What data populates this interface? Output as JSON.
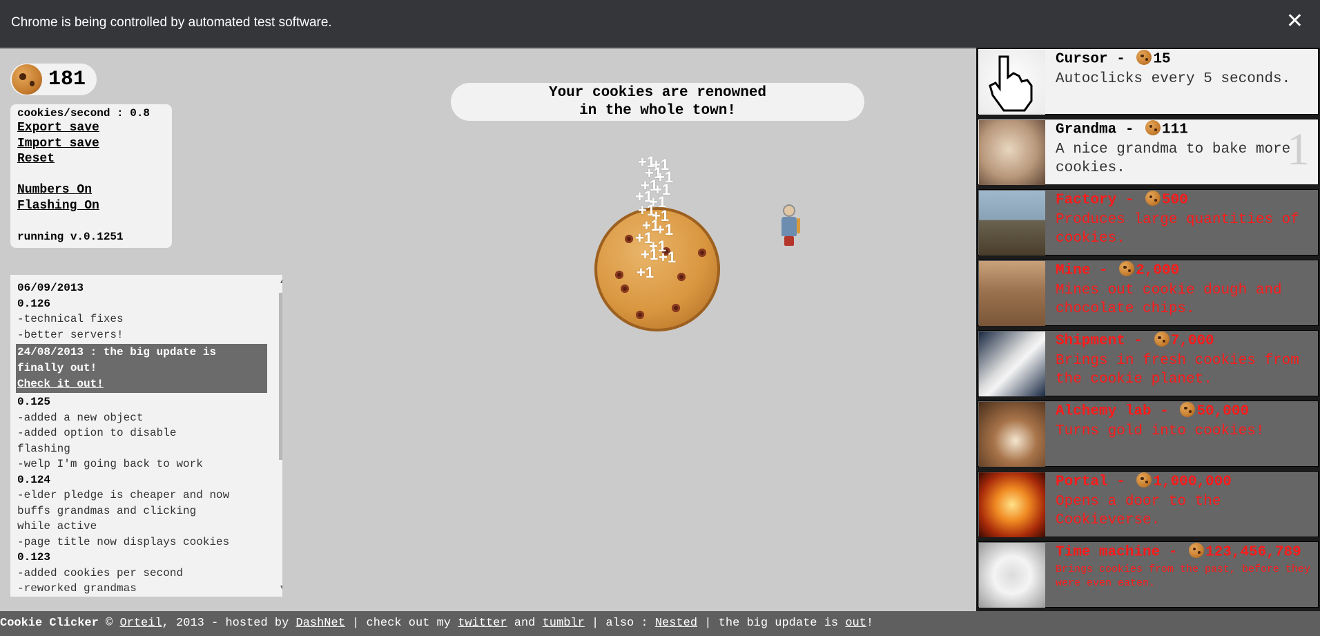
{
  "automation_bar": {
    "message": "Chrome is being controlled by automated test software.",
    "close_glyph": "✕"
  },
  "counter": {
    "cookies": "181",
    "icon": "cookie-icon"
  },
  "stats": {
    "cps": "cookies/second : 0.8",
    "export": "Export save",
    "import": "Import save",
    "reset": "Reset",
    "numbers": "Numbers On",
    "flashing": "Flashing On",
    "version": "running v.0.1251"
  },
  "news": {
    "lines": [
      {
        "text": "06/09/2013",
        "type": "head"
      },
      {
        "text": "0.126",
        "type": "head"
      },
      {
        "text": "-technical fixes",
        "type": "sub"
      },
      {
        "text": "-better servers!",
        "type": "sub"
      }
    ],
    "highlight": {
      "line1": "24/08/2013 : the big update is",
      "line2": "finally out!",
      "link": "Check it out!"
    },
    "lines2": [
      {
        "text": "0.125",
        "type": "head"
      },
      {
        "text": "-added a new object",
        "type": "sub"
      },
      {
        "text": "-added option to disable",
        "type": "sub"
      },
      {
        "text": "flashing",
        "type": "sub"
      },
      {
        "text": "-welp I'm going back to work",
        "type": "sub"
      },
      {
        "text": "0.124",
        "type": "head"
      },
      {
        "text": "-elder pledge is cheaper and now",
        "type": "sub"
      },
      {
        "text": "buffs grandmas and clicking",
        "type": "sub"
      },
      {
        "text": "while active",
        "type": "sub"
      },
      {
        "text": "-page title now displays cookies",
        "type": "sub"
      },
      {
        "text": "0.123",
        "type": "head"
      },
      {
        "text": "-added cookies per second",
        "type": "sub"
      },
      {
        "text": "-reworked grandmas",
        "type": "sub"
      }
    ],
    "scroll_up": "▲",
    "scroll_down": "▼"
  },
  "headline": {
    "line1": "Your cookies are renowned",
    "line2": "in the whole town!"
  },
  "floating_text": "+1",
  "store": {
    "items": [
      {
        "name": "Cursor",
        "price": "15",
        "desc": "Autoclicks every 5 seconds.",
        "state": "on",
        "owned": ""
      },
      {
        "name": "Grandma",
        "price": "111",
        "desc": "A nice grandma to bake more cookies.",
        "state": "on",
        "owned": "1"
      },
      {
        "name": "Factory",
        "price": "500",
        "desc": "Produces large quantities of cookies.",
        "state": "off",
        "owned": ""
      },
      {
        "name": "Mine",
        "price": "2,000",
        "desc": "Mines out cookie dough and chocolate chips.",
        "state": "off",
        "owned": ""
      },
      {
        "name": "Shipment",
        "price": "7,000",
        "desc": "Brings in fresh cookies from the cookie planet.",
        "state": "off",
        "owned": ""
      },
      {
        "name": "Alchemy lab",
        "price": "50,000",
        "desc": "Turns gold into cookies!",
        "state": "off",
        "owned": ""
      },
      {
        "name": "Portal",
        "price": "1,000,000",
        "desc": "Opens a door to the Cookieverse.",
        "state": "off",
        "owned": ""
      },
      {
        "name": "Time machine",
        "price": "123,456,789",
        "desc": "Brings cookies from the past, before they were even eaten.",
        "state": "off",
        "owned": ""
      }
    ]
  },
  "footer": {
    "brand": "Cookie Clicker",
    "copy": " © ",
    "author": "Orteil",
    "mid1": ", 2013 - hosted by ",
    "host": "DashNet",
    "mid2": " | check out my ",
    "twitter": "twitter",
    "and": " and ",
    "tumblr": "tumblr",
    "mid3": " | also : ",
    "nested": "Nested",
    "mid4": " | the big update is ",
    "out": "out",
    "end": "!"
  }
}
